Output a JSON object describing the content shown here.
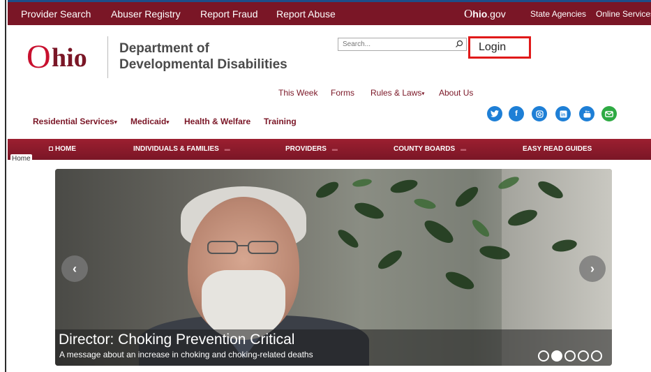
{
  "topbar": {
    "links": [
      "Provider Search",
      "Abuser Registry",
      "Report Fraud",
      "Report Abuse"
    ],
    "ohio_gov_o": "O",
    "ohio_gov_hio": "hio",
    "ohio_gov_suffix": ".gov",
    "right_links": [
      "State Agencies",
      "Online Services"
    ],
    "color": "#7a1626"
  },
  "header": {
    "logo_o": "O",
    "logo_hio": "hio",
    "dept_line1": "Department of",
    "dept_line2": "Developmental Disabilities",
    "search_placeholder": "Search...",
    "login_label": "Login"
  },
  "utility_nav": [
    {
      "label": "This Week",
      "dropdown": false
    },
    {
      "label": "Forms",
      "dropdown": false
    },
    {
      "label": "Rules & Laws",
      "dropdown": true
    },
    {
      "label": "About Us",
      "dropdown": false
    }
  ],
  "main_nav": [
    {
      "label": "Residential Services",
      "dropdown": true
    },
    {
      "label": "Medicaid",
      "dropdown": true
    },
    {
      "label": "Health & Welfare",
      "dropdown": false
    },
    {
      "label": "Training",
      "dropdown": false
    }
  ],
  "social_icons": [
    "twitter-icon",
    "facebook-icon",
    "instagram-icon",
    "linkedin-icon",
    "youtube-icon",
    "email-icon"
  ],
  "red_nav": [
    "HOME",
    "INDIVIDUALS & FAMILIES",
    "PROVIDERS",
    "COUNTY BOARDS",
    "EASY READ GUIDES"
  ],
  "breadcrumb": "Home",
  "hero": {
    "title": "Director: Choking Prevention Critical",
    "subtitle": "A message about an increase in choking and choking-related deaths",
    "slide_count": 5,
    "active_slide": 2
  }
}
